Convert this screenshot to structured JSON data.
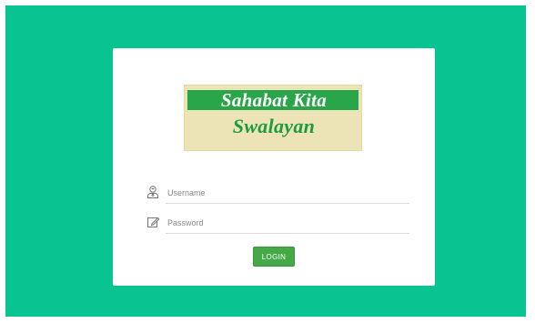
{
  "logo": {
    "line1": "Sahabat Kita",
    "line2": "Swalayan"
  },
  "form": {
    "username": {
      "icon": "user-icon",
      "placeholder": "Username",
      "value": ""
    },
    "password": {
      "icon": "edit-icon",
      "placeholder": "Password",
      "value": ""
    },
    "login_label": "LOGIN"
  },
  "colors": {
    "background": "#09c391",
    "card": "#ffffff",
    "logo_bg": "#ece4b6",
    "logo_band": "#2aa64a",
    "logo_text_green": "#1e9a40",
    "button": "#46a948"
  }
}
